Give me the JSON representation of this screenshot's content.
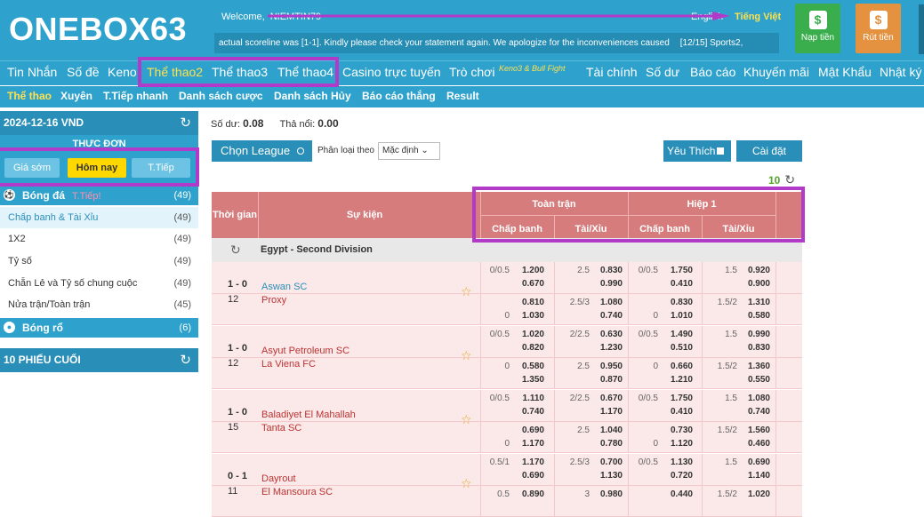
{
  "header": {
    "logo": "ONEBOX63",
    "welcome": "Welcome,",
    "username": "NIEMTIN79",
    "lang_en": "English",
    "lang_vi": "Tiếng Việt",
    "ticker_a": "actual scoreline was [1-1]. Kindly please check your statement again. We apologize for the inconveniences caused",
    "ticker_b": "[12/15] Sports2,",
    "deposit": "Nạp tiền",
    "withdraw": "Rút tiền",
    "deposit_icon": "dollar-icon",
    "withdraw_icon": "dollar-icon"
  },
  "nav": [
    "Tin Nhắn",
    "Số đề",
    "Keno",
    "Thể thao2",
    "Thể thao3",
    "Thể thao4",
    "Casino trực tuyến",
    "Trò chơi",
    "Tài chính",
    "Số dư",
    "Báo cáo",
    "Khuyến mãi",
    "Mật Khẩu",
    "Nhật ký"
  ],
  "nav_sup": "Keno3 & Bull Fight",
  "subnav": [
    "Thể thao",
    "Xuyên",
    "T.Tiếp nhanh",
    "Danh sách cược",
    "Danh sách Hủy",
    "Báo cáo thắng",
    "Result"
  ],
  "sidebar": {
    "date": "2024-12-16 VND",
    "menu_title": "THỰC ĐƠN",
    "tabs": [
      "Giá sớm",
      "Hôm nay",
      "T.Tiếp"
    ],
    "football": "Bóng đá",
    "football_live": "T.Tiếp!",
    "football_count": "(49)",
    "items": [
      {
        "label": "Chấp banh & Tài Xỉu",
        "count": "(49)"
      },
      {
        "label": "1X2",
        "count": "(49)"
      },
      {
        "label": "Tỷ số",
        "count": "(49)"
      },
      {
        "label": "Chẵn Lẻ và Tỷ số chung cuộc",
        "count": "(49)"
      },
      {
        "label": "Nửa trận/Toàn trận",
        "count": "(45)"
      }
    ],
    "basketball": "Bóng rổ",
    "basketball_count": "(6)",
    "tickets": "10 PHIẾU CUỐI"
  },
  "main": {
    "balance_label": "Số dư:",
    "balance": "0.08",
    "credit_label": "Thả nổi:",
    "credit": "0.00",
    "league_btn": "Chọn League",
    "sort_label": "Phân loại theo",
    "sort_value": "Mặc định",
    "fav": "Yêu Thích",
    "settings": "Cài đặt",
    "count": "10"
  },
  "table": {
    "time": "Thời gian",
    "event": "Sự kiện",
    "full": "Toàn trận",
    "half": "Hiệp 1",
    "hdp": "Chấp banh",
    "ou": "Tài/Xỉu",
    "league": "Egypt - Second Division"
  },
  "matches": [
    {
      "score": "1 - 0",
      "minute": "12",
      "home": "Aswan SC",
      "away": "Proxy",
      "home_fav": true,
      "r1": {
        "fh": "0/0.5",
        "fo": "1.200",
        "fu": "2.5",
        "fuo": "0.830",
        "hh": "0/0.5",
        "ho": "1.750",
        "hu": "1.5",
        "huo": "0.920"
      },
      "r1b": {
        "fo": "0.670",
        "fuo": "0.990",
        "ho": "0.410",
        "huo": "0.900"
      },
      "r2": {
        "fh": "",
        "fo": "0.810",
        "fu": "2.5/3",
        "fuo": "1.080",
        "hh": "",
        "ho": "0.830",
        "hu": "1.5/2",
        "huo": "1.310"
      },
      "r2b": {
        "fh": "0",
        "fo": "1.030",
        "fuo": "0.740",
        "hh": "0",
        "ho": "1.010",
        "huo": "0.580"
      }
    },
    {
      "score": "1 - 0",
      "minute": "12",
      "home": "Asyut Petroleum SC",
      "away": "La Viena FC",
      "home_fav": false,
      "r1": {
        "fh": "0/0.5",
        "fo": "1.020",
        "fu": "2/2.5",
        "fuo": "0.630",
        "hh": "0/0.5",
        "ho": "1.490",
        "hu": "1.5",
        "huo": "0.990"
      },
      "r1b": {
        "fo": "0.820",
        "fuo": "1.230",
        "ho": "0.510",
        "huo": "0.830"
      },
      "r2": {
        "fh": "0",
        "fo": "0.580",
        "fu": "2.5",
        "fuo": "0.950",
        "hh": "0",
        "ho": "0.660",
        "hu": "1.5/2",
        "huo": "1.360"
      },
      "r2b": {
        "fh": "",
        "fo": "1.350",
        "fuo": "0.870",
        "hh": "",
        "ho": "1.210",
        "huo": "0.550"
      }
    },
    {
      "score": "1 - 0",
      "minute": "15",
      "home": "Baladiyet El Mahallah",
      "away": "Tanta SC",
      "home_fav": false,
      "r1": {
        "fh": "0/0.5",
        "fo": "1.110",
        "fu": "2/2.5",
        "fuo": "0.670",
        "hh": "0/0.5",
        "ho": "1.750",
        "hu": "1.5",
        "huo": "1.080"
      },
      "r1b": {
        "fo": "0.740",
        "fuo": "1.170",
        "ho": "0.410",
        "huo": "0.740"
      },
      "r2": {
        "fh": "",
        "fo": "0.690",
        "fu": "2.5",
        "fuo": "1.040",
        "hh": "",
        "ho": "0.730",
        "hu": "1.5/2",
        "huo": "1.560"
      },
      "r2b": {
        "fh": "0",
        "fo": "1.170",
        "fuo": "0.780",
        "hh": "0",
        "ho": "1.120",
        "huo": "0.460"
      }
    },
    {
      "score": "0 - 1",
      "minute": "11",
      "home": "Dayrout",
      "away": "El Mansoura SC",
      "home_fav": false,
      "r1": {
        "fh": "0.5/1",
        "fo": "1.170",
        "fu": "2.5/3",
        "fuo": "0.700",
        "hh": "0/0.5",
        "ho": "1.130",
        "hu": "1.5",
        "huo": "0.690"
      },
      "r1b": {
        "fo": "0.690",
        "fuo": "1.130",
        "ho": "0.720",
        "huo": "1.140"
      },
      "r2": {
        "fh": "0.5",
        "fo": "0.890",
        "fu": "3",
        "fuo": "0.980",
        "hh": "",
        "ho": "0.440",
        "hu": "1.5/2",
        "huo": "1.020"
      },
      "r2b": {
        "fh": "",
        "fo": "",
        "fuo": "",
        "hh": "",
        "ho": "",
        "huo": ""
      }
    }
  ]
}
